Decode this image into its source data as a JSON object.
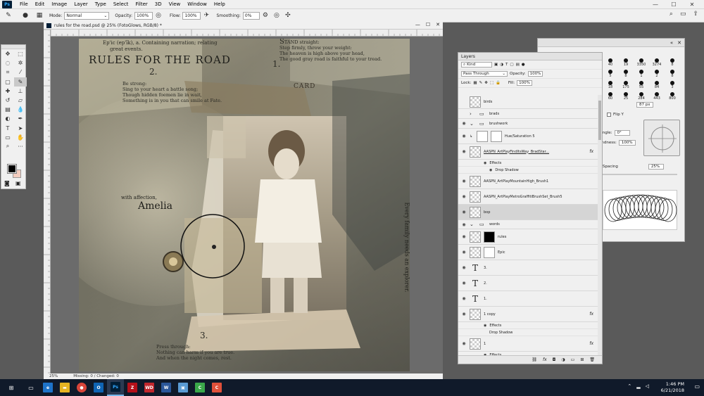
{
  "menu": {
    "items": [
      "File",
      "Edit",
      "Image",
      "Layer",
      "Type",
      "Select",
      "Filter",
      "3D",
      "View",
      "Window",
      "Help"
    ],
    "window_controls": [
      "—",
      "☐",
      "✕"
    ]
  },
  "options": {
    "mode_label": "Mode:",
    "mode_value": "Normal",
    "opacity_label": "Opacity:",
    "opacity_value": "100%",
    "flow_label": "Flow:",
    "flow_value": "100%",
    "smoothing_label": "Smoothing:",
    "smoothing_value": "0%"
  },
  "document": {
    "tab_title": "rules for the road.psd @ 25% (FotoGlows, RGB/8) *",
    "zoom": "25%",
    "status": "Missing: 0 / Changed: 0"
  },
  "artwork": {
    "epic_line1": "Ep'ic (ep'ĭk), a.  Containing narration; relating",
    "epic_line2": "great events.",
    "title": "RULES FOR THE ROAD",
    "n2": "2.",
    "verse2": [
      "Be strong:",
      "Sing to your heart a battle song;",
      "Though hidden foemen lie in wait,",
      "Something is in you that can smile at Fate."
    ],
    "n1": "1.",
    "verse1_cap": "S",
    "verse1": [
      "TAND straight:",
      "Step firmly, throw your weight:",
      "The heaven is high above your head,",
      "The good gray road is faithful to your tread."
    ],
    "card": "CARD",
    "with_fondly": "with affection,",
    "name": "Amelia",
    "side_text": "Every family needs an explorer.",
    "n3": "3.",
    "verse3": [
      "Press through:",
      "Nothing can harm if you are true.",
      "And when the night comes, rest."
    ]
  },
  "layers_panel": {
    "title": "Layers",
    "kind_label": "Kind",
    "blend_mode": "Pass Through",
    "opacity_label": "Opacity:",
    "opacity_value": "100%",
    "lock_label": "Lock:",
    "fill_label": "Fill:",
    "fill_value": "100%",
    "layers": [
      {
        "name": "birds",
        "type": "pixel",
        "visible": false
      },
      {
        "name": "brads",
        "type": "group",
        "visible": false
      },
      {
        "name": "brushwork",
        "type": "group",
        "visible": true
      },
      {
        "name": "Hue/Saturation 5",
        "type": "adjustment",
        "visible": true
      },
      {
        "name": "AASPN_ArtPlayFindItsWay_BradStar...",
        "type": "pixel",
        "visible": true,
        "fx": "fx"
      },
      {
        "name": "AASPN_ArtPlayMountainHigh_Brush1",
        "type": "pixel",
        "visible": true
      },
      {
        "name": "AASPN_ArtPlayMetroGraffitiBrushSet_Brush5",
        "type": "pixel",
        "visible": true
      },
      {
        "name": "bop",
        "type": "pixel",
        "visible": true,
        "selected": true
      },
      {
        "name": "words",
        "type": "group",
        "visible": true
      },
      {
        "name": "rules",
        "type": "masked",
        "visible": true
      },
      {
        "name": "Epic",
        "type": "masked",
        "visible": true
      },
      {
        "name": "3.",
        "type": "text",
        "visible": true
      },
      {
        "name": "2.",
        "type": "text",
        "visible": true
      },
      {
        "name": "1.",
        "type": "text",
        "visible": true
      },
      {
        "name": "1 copy",
        "type": "pixel",
        "visible": true,
        "fx": "fx"
      },
      {
        "name": "1",
        "type": "pixel",
        "visible": true,
        "fx": "fx"
      }
    ],
    "effects_label": "Effects",
    "drop_shadow_label": "Drop Shadow"
  },
  "brush_panel": {
    "sizes": [
      "40",
      "19",
      "3350",
      "3274",
      "8",
      "5",
      "8",
      "1",
      "2",
      "8",
      "18",
      "175",
      "55",
      "84",
      "3",
      "60",
      "25",
      "284",
      "443",
      "800"
    ],
    "size_value": "87 px",
    "flip_y_label": "Flip Y",
    "angle_label": "Angle:",
    "angle_value": "0°",
    "roundness_label": "Roundness:",
    "roundness_value": "100%",
    "spacing_label": "Spacing",
    "spacing_value": "25%"
  },
  "taskbar": {
    "time": "1:46 PM",
    "date": "6/21/2018"
  },
  "colors": {
    "foreground": "#000000",
    "background": "#f4cdbf",
    "taskbar": "#101a2a",
    "workspace": "#5a5a5a"
  }
}
